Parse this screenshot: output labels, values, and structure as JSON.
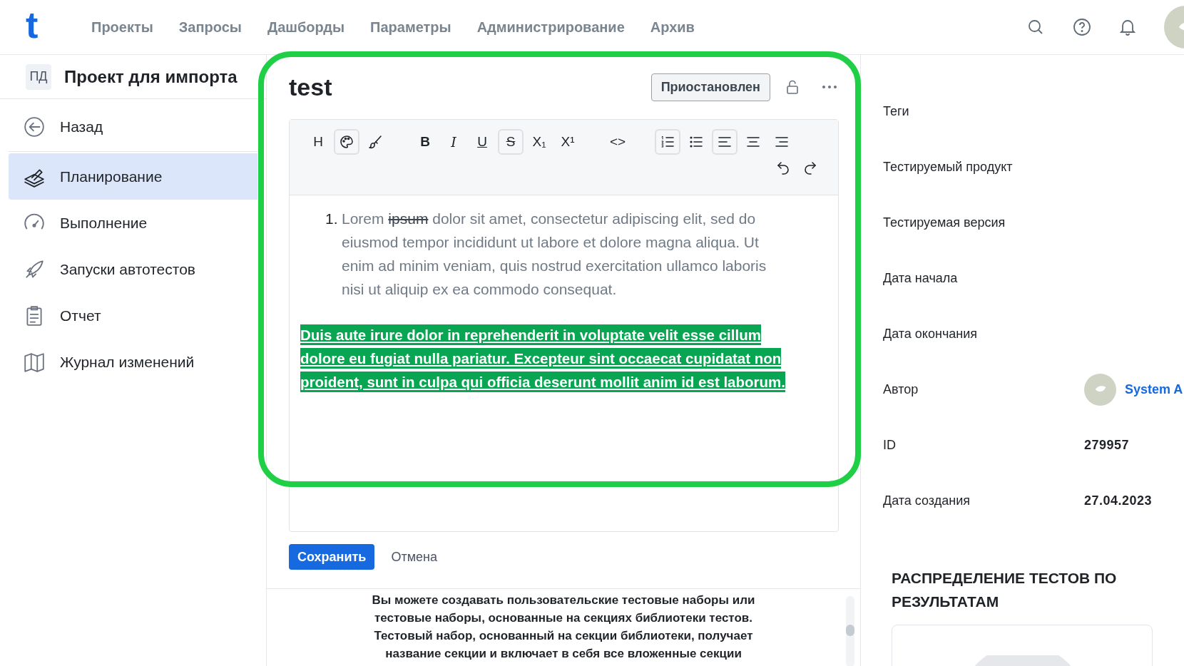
{
  "header": {
    "logo": "t",
    "nav": [
      {
        "label": "Проекты"
      },
      {
        "label": "Запросы"
      },
      {
        "label": "Дашборды"
      },
      {
        "label": "Параметры"
      },
      {
        "label": "Администрирование"
      },
      {
        "label": "Архив"
      }
    ]
  },
  "sidebar": {
    "project_badge": "ПД",
    "project_title": "Проект для импорта",
    "items": [
      {
        "label": "Назад",
        "kind": "back",
        "selected": false
      },
      {
        "label": "Планирование",
        "kind": "planning",
        "selected": true
      },
      {
        "label": "Выполнение",
        "kind": "gauge",
        "selected": false
      },
      {
        "label": "Запуски автотестов",
        "kind": "rocket",
        "selected": false
      },
      {
        "label": "Отчет",
        "kind": "report",
        "selected": false
      },
      {
        "label": "Журнал изменений",
        "kind": "map",
        "selected": false
      }
    ]
  },
  "main": {
    "title": "test",
    "status": "Приостановлен",
    "toolbar": [
      {
        "kind": "glyph",
        "label": "H",
        "active": false
      },
      {
        "kind": "palette",
        "active": true
      },
      {
        "kind": "brush",
        "active": false
      },
      {
        "kind": "glyph",
        "label": "B",
        "active": false
      },
      {
        "kind": "glyph",
        "label": "I",
        "active": false
      },
      {
        "kind": "glyph",
        "label": "U",
        "active": false
      },
      {
        "kind": "glyph",
        "label": "S",
        "active": true
      },
      {
        "kind": "glyph",
        "label": "X₁",
        "active": false
      },
      {
        "kind": "glyph",
        "label": "X¹",
        "active": false
      },
      {
        "kind": "glyph",
        "label": "<>",
        "active": false
      },
      {
        "kind": "ordered-list",
        "active": true
      },
      {
        "kind": "bullet-list",
        "active": false
      },
      {
        "kind": "align-left",
        "active": true
      },
      {
        "kind": "align-center",
        "active": false
      },
      {
        "kind": "align-right",
        "active": false
      }
    ],
    "toolbar_row2": [
      {
        "kind": "undo"
      },
      {
        "kind": "redo"
      }
    ],
    "content": [
      {
        "kind": "ordered",
        "number": "1.",
        "segments": [
          {
            "text": "Lorem ",
            "strike": false
          },
          {
            "text": "ipsum",
            "strike": true
          },
          {
            "text": " dolor sit amet, consectetur adipiscing elit, sed do eiusmod tempor incididunt ut labore et dolore magna aliqua. Ut enim ad minim veniam, quis nostrud exercitation ullamco laboris nisi ut aliquip ex ea commodo consequat.",
            "strike": false
          }
        ]
      },
      {
        "kind": "highlighted",
        "text": " Duis aute irure dolor in reprehenderit in voluptate velit esse cillum dolore eu fugiat nulla pariatur. Excepteur sint occaecat cupidatat non proident, sunt in culpa qui officia deserunt mollit anim id est laborum."
      }
    ],
    "save": "Сохранить",
    "cancel": "Отмена",
    "help_lines": [
      "Вы можете создавать пользовательские тестовые наборы или",
      "тестовые наборы, основанные на секциях библиотеки тестов.",
      "Тестовый набор, основанный на секции библиотеки, получает",
      "название секции и включает в себя все вложенные секции"
    ]
  },
  "details": [
    {
      "label": "Теги"
    },
    {
      "label": "Тестируемый продукт"
    },
    {
      "label": "Тестируемая версия"
    },
    {
      "label": "Дата начала"
    },
    {
      "label": "Дата окончания"
    },
    {
      "label": "Автор",
      "value": "System A",
      "kind": "user"
    },
    {
      "label": "ID",
      "value": "279957",
      "kind": "text"
    },
    {
      "label": "Дата создания",
      "value": "27.04.2023",
      "kind": "text"
    }
  ],
  "chart_heading": "РАСПРЕДЕЛЕНИЕ ТЕСТОВ ПО РЕЗУЛЬТАТАМ"
}
